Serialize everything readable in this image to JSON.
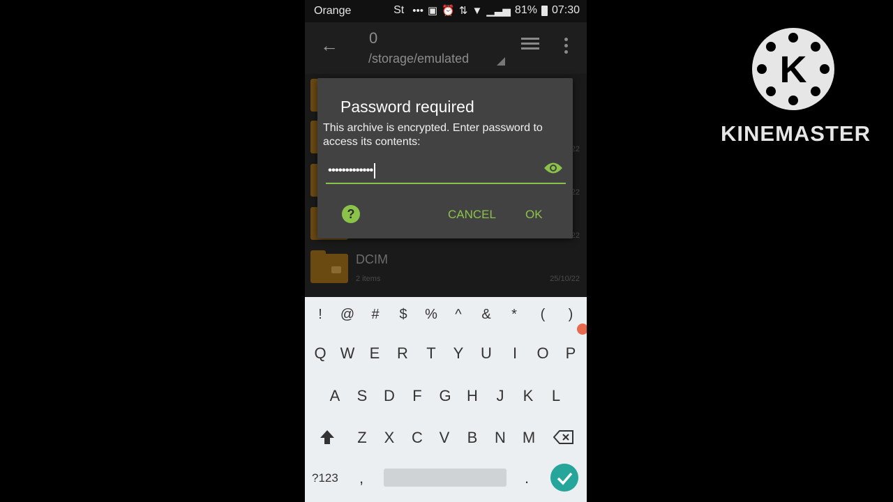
{
  "status_bar": {
    "carrier": "Orange",
    "notification_text": "St",
    "battery": "81%",
    "time": "07:30"
  },
  "app_bar": {
    "path_top": "0",
    "path_bottom": "/storage/emulated"
  },
  "file_list": {
    "folder": {
      "name": "DCIM",
      "items": "2 items",
      "date": "25/10/22"
    },
    "partial_dates": [
      "22",
      "22",
      "22"
    ]
  },
  "dialog": {
    "title": "Password required",
    "message": "This archive is encrypted. Enter password to access its contents:",
    "password_value": "•••••••••••••",
    "cancel_label": "CANCEL",
    "ok_label": "OK",
    "help_label": "?"
  },
  "keyboard": {
    "symbols": [
      "!",
      "@",
      "#",
      "$",
      "%",
      "^",
      "&",
      "*",
      "(",
      ")"
    ],
    "row1": [
      "Q",
      "W",
      "E",
      "R",
      "T",
      "Y",
      "U",
      "I",
      "O",
      "P"
    ],
    "row2": [
      "A",
      "S",
      "D",
      "F",
      "G",
      "H",
      "J",
      "K",
      "L"
    ],
    "row3": [
      "Z",
      "X",
      "C",
      "V",
      "B",
      "N",
      "M"
    ],
    "mode_label": "?123",
    "comma": ",",
    "period": "."
  },
  "watermark": {
    "brand": "KINEMASTER",
    "logo_letter": "K"
  },
  "colors": {
    "accent": "#8bc34a",
    "done_button": "#26a69a",
    "keyboard_bg": "#eceff1"
  }
}
